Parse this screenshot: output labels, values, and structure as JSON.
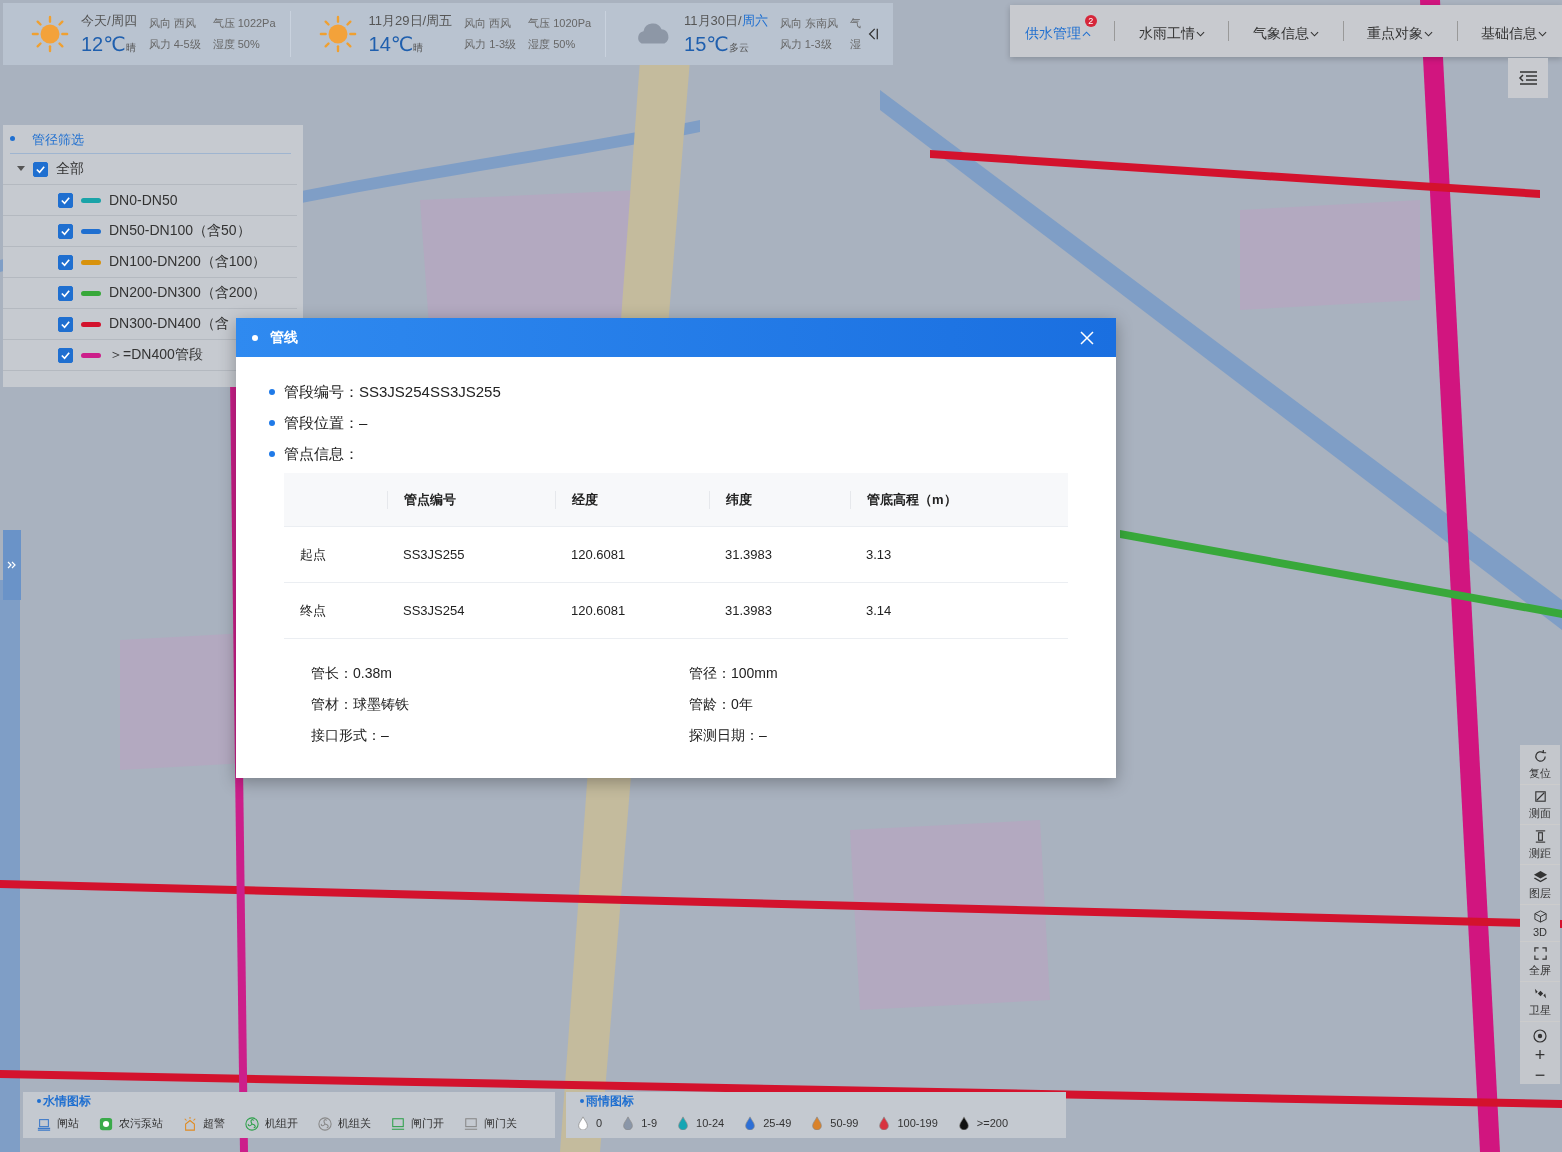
{
  "weather": {
    "days": [
      {
        "date": "今天/",
        "weekday": "周四",
        "weekend": false,
        "kind": "sunny",
        "temp": "12℃",
        "desc": "晴",
        "col_a": [
          "风向 西风",
          "风力 4-5级"
        ],
        "col_b": [
          "气压 1022Pa",
          "湿度 50%"
        ]
      },
      {
        "date": "11月29日/",
        "weekday": "周五",
        "weekend": false,
        "kind": "sunny",
        "temp": "14℃",
        "desc": "晴",
        "col_a": [
          "风向 西风",
          "风力 1-3级"
        ],
        "col_b": [
          "气压 1020Pa",
          "湿度 50%"
        ]
      },
      {
        "date": "11月30日/",
        "weekday": "周六",
        "weekend": true,
        "kind": "cloudy",
        "temp": "15℃",
        "desc": "多云",
        "col_a": [
          "风向 东南风",
          "风力 1-3级"
        ],
        "col_b": [
          "气",
          "湿"
        ]
      }
    ]
  },
  "nav": {
    "tabs": [
      {
        "label": "供水管理",
        "selected": true,
        "badge": "2"
      },
      {
        "label": "水雨工情",
        "selected": false
      },
      {
        "label": "气象信息",
        "selected": false
      },
      {
        "label": "重点对象",
        "selected": false
      },
      {
        "label": "基础信息",
        "selected": false
      }
    ]
  },
  "filter": {
    "title": "管径筛选",
    "tree": [
      {
        "label": "全部",
        "checked": true,
        "expanded": true,
        "children": [
          {
            "label": "DN0-DN50",
            "checked": true,
            "color": "#1aa3a8"
          },
          {
            "label": "DN50-DN100（含50）",
            "checked": true,
            "color": "#1f6fd0"
          },
          {
            "label": "DN100-DN200（含100）",
            "checked": true,
            "color": "#d8920c"
          },
          {
            "label": "DN200-DN300（含200）",
            "checked": true,
            "color": "#38a83a"
          },
          {
            "label": "DN300-DN400（含",
            "checked": true,
            "color": "#d3122d"
          },
          {
            "label": "＞=DN400管段",
            "checked": true,
            "color": "#cc1f8a"
          }
        ]
      }
    ]
  },
  "tools": [
    {
      "kind": "reset",
      "label": "复位"
    },
    {
      "kind": "area",
      "label": "测面"
    },
    {
      "kind": "distance",
      "label": "测距"
    },
    {
      "kind": "layers",
      "label": "图层"
    },
    {
      "kind": "cube",
      "label": "3D"
    },
    {
      "kind": "fullscreen",
      "label": "全屏"
    },
    {
      "kind": "satellite",
      "label": "卫星"
    }
  ],
  "zoom_controls": [
    "+",
    "−"
  ],
  "water_legend": {
    "title": "水情图标",
    "items": [
      {
        "kind": "gate-station",
        "label": "闸站"
      },
      {
        "kind": "pump",
        "label": "农污泵站"
      },
      {
        "kind": "alarm",
        "label": "超警"
      },
      {
        "kind": "unit-on",
        "label": "机组开"
      },
      {
        "kind": "unit-off",
        "label": "机组关"
      },
      {
        "kind": "gate-open",
        "label": "闸门开"
      },
      {
        "kind": "gate-closed",
        "label": "闸门关"
      }
    ]
  },
  "rain_legend": {
    "title": "雨情图标",
    "items": [
      {
        "label": "0",
        "color": "#ffffff"
      },
      {
        "label": "1-9",
        "color": "#8a96a8"
      },
      {
        "label": "10-24",
        "color": "#14a6b4"
      },
      {
        "label": "25-49",
        "color": "#2d6fd6"
      },
      {
        "label": "50-99",
        "color": "#d9822b"
      },
      {
        "label": "100-199",
        "color": "#d8343f"
      },
      {
        "label": ">=200",
        "color": "#111111"
      }
    ]
  },
  "modal": {
    "title": "管线",
    "fields": [
      "管段编号：SS3JS254SS3JS255",
      "管段位置：–",
      "管点信息："
    ],
    "table": {
      "columns": [
        "管点编号",
        "经度",
        "纬度",
        "管底高程（m）"
      ],
      "rows": [
        {
          "label": "起点",
          "cells": [
            "SS3JS255",
            "120.6081",
            "31.3983",
            "3.13"
          ]
        },
        {
          "label": "终点",
          "cells": [
            "SS3JS254",
            "120.6081",
            "31.3983",
            "3.14"
          ]
        }
      ]
    },
    "details": [
      "管长：0.38m",
      "管径：100mm",
      "管材：球墨铸铁",
      "管龄：0年",
      "接口形式：–",
      "探测日期：–"
    ]
  }
}
